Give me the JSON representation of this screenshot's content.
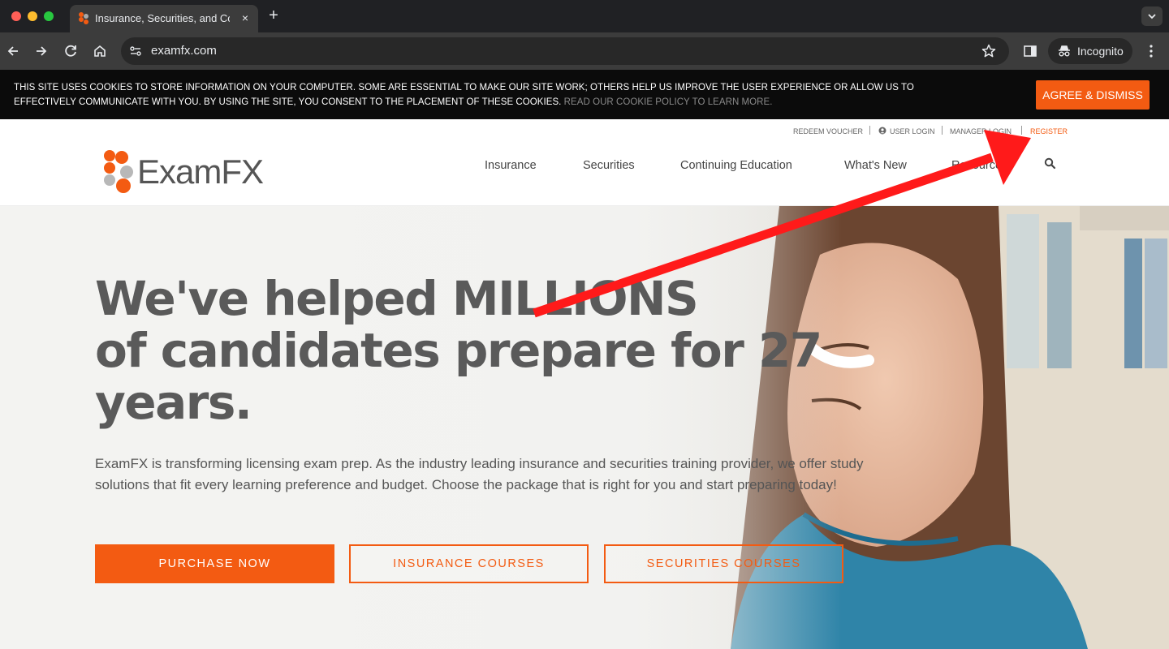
{
  "browser": {
    "tab_title": "Insurance, Securities, and Co",
    "tab_close": "×",
    "new_tab": "+",
    "url": "examfx.com",
    "incognito_label": "Incognito",
    "icons": [
      "back-icon",
      "forward-icon",
      "reload-icon",
      "home-icon",
      "site-settings-icon",
      "bookmark-star-icon",
      "side-panel-icon",
      "incognito-icon",
      "menu-icon",
      "tab-search-icon"
    ]
  },
  "cookie_banner": {
    "text": "THIS SITE USES COOKIES TO STORE INFORMATION ON YOUR COMPUTER. SOME ARE ESSENTIAL TO MAKE OUR SITE WORK; OTHERS HELP US IMPROVE THE USER EXPERIENCE OR ALLOW US TO EFFECTIVELY COMMUNICATE WITH YOU. BY USING THE SITE, YOU CONSENT TO THE PLACEMENT OF THESE COOKIES.",
    "link": "READ OUR COOKIE POLICY TO LEARN MORE.",
    "button": "AGREE & DISMISS"
  },
  "utility_nav": {
    "redeem_voucher": "REDEEM VOUCHER",
    "user_login": "USER LOGIN",
    "manager_login": "MANAGER LOGIN",
    "register": "REGISTER"
  },
  "logo": {
    "text": "ExamFX"
  },
  "main_nav": {
    "items": [
      "Insurance",
      "Securities",
      "Continuing Education",
      "What's New",
      "Resources"
    ]
  },
  "hero": {
    "headline_line1": "We've helped MILLIONS",
    "headline_line2": "of candidates prepare for 27",
    "headline_line3": "years.",
    "subcopy": "ExamFX is transforming licensing exam prep. As the industry leading insurance and securities training provider, we offer study solutions that fit every learning preference and budget. Choose the package that is right for you and start preparing today!",
    "buttons": {
      "purchase": "PURCHASE NOW",
      "insurance": "INSURANCE COURSES",
      "securities": "SECURITIES COURSES"
    }
  },
  "colors": {
    "accent": "#f35b12",
    "cookie_bg": "#0b0b0b",
    "chrome_dark": "#202124",
    "chrome_toolbar": "#3c3c3c",
    "headline": "#5a5a5a",
    "annotation_arrow": "#ff1a1a"
  }
}
